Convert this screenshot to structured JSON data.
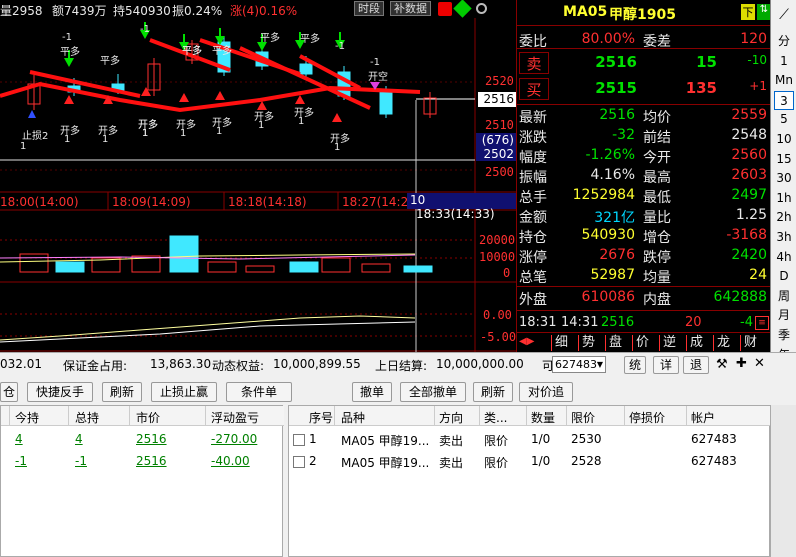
{
  "info": {
    "vol": "量2958",
    "amount": "额7439万",
    "hold": "持540930",
    "amp": "振0.24%",
    "chg": "涨(4)0.16%",
    "btn_period": "时段",
    "btn_supplement": "补数据"
  },
  "chart": {
    "price_labels": [
      "2520",
      "2516",
      "2510",
      "(676)",
      "2502",
      "2500"
    ],
    "vol_labels": [
      "20000",
      "10000",
      "0"
    ],
    "osc_labels": [
      "0.00",
      "-5.00"
    ],
    "time_labels": [
      "18:00(14:00)",
      "18:09(14:09)",
      "18:18(14:18)",
      "18:27(14:2",
      "10",
      "18:33(14:33)"
    ],
    "annotations": [
      {
        "text": "-1"
      },
      {
        "text": "平多"
      },
      {
        "text": "-1"
      },
      {
        "text": "平多"
      },
      {
        "text": "平多"
      },
      {
        "text": "平多"
      },
      {
        "text": "平多"
      },
      {
        "text": "平多"
      },
      {
        "text": "-1"
      },
      {
        "text": "平多"
      },
      {
        "text": "-1"
      },
      {
        "text": "开空"
      },
      {
        "text": "止损2"
      },
      {
        "text": "1"
      },
      {
        "text": "开多"
      },
      {
        "text": "1"
      },
      {
        "text": "开多"
      },
      {
        "text": "1"
      },
      {
        "text": "开多"
      },
      {
        "text": "1"
      },
      {
        "text": "开多"
      },
      {
        "text": "1"
      },
      {
        "text": "开多"
      },
      {
        "text": "1"
      },
      {
        "text": "开多"
      },
      {
        "text": "1"
      },
      {
        "text": "开多"
      },
      {
        "text": "1"
      },
      {
        "text": "开多"
      },
      {
        "text": "1"
      },
      {
        "text": "开多"
      },
      {
        "text": "1"
      }
    ]
  },
  "quote": {
    "symbol": "MA05",
    "name": "甲醇1905",
    "tag_down": "下",
    "rows": [
      {
        "l": "委比",
        "v": "80.00%",
        "l2": "委差",
        "v2": "120"
      },
      {
        "l": "卖",
        "v": "2516",
        "v2": "15",
        "v3": "-10"
      },
      {
        "l": "买",
        "v": "2515",
        "v2": "135",
        "v3": "+1"
      },
      {
        "l": "最新",
        "v": "2516",
        "l2": "均价",
        "v2": "2559"
      },
      {
        "l": "涨跌",
        "v": "-32",
        "l2": "前结",
        "v2": "2548"
      },
      {
        "l": "幅度",
        "v": "-1.26%",
        "l2": "今开",
        "v2": "2560"
      },
      {
        "l": "振幅",
        "v": "4.16%",
        "l2": "最高",
        "v2": "2603"
      },
      {
        "l": "总手",
        "v": "1252984",
        "l2": "最低",
        "v2": "2497"
      },
      {
        "l": "金额",
        "v": "321亿",
        "l2": "量比",
        "v2": "1.25"
      },
      {
        "l": "持仓",
        "v": "540930",
        "l2": "增仓",
        "v2": "-3168"
      },
      {
        "l": "涨停",
        "v": "2676",
        "l2": "跌停",
        "v2": "2420"
      },
      {
        "l": "总笔",
        "v": "52987",
        "l2": "均量",
        "v2": "24"
      },
      {
        "l": "外盘",
        "v": "610086",
        "l2": "内盘",
        "v2": "642888"
      }
    ],
    "tick": {
      "time1": "18:31",
      "time2": "14:31",
      "price": "2516",
      "vol": "20",
      "chg": "-4"
    },
    "tabs": [
      "细",
      "势",
      "盘",
      "价",
      "逆",
      "成",
      "龙",
      "财"
    ]
  },
  "rightbar": [
    "分",
    "1",
    "Mn",
    "3",
    "5",
    "10",
    "15",
    "30",
    "1h",
    "2h",
    "3h",
    "4h",
    "D",
    "周",
    "月",
    "季",
    "年"
  ],
  "account": {
    "available": "032.01",
    "margin_label": "保证金占用:",
    "margin": "13,863.30",
    "equity_label": "动态权益:",
    "equity": "10,000,899.55",
    "settle_label": "上日结算:",
    "settle": "10,000,000.00",
    "ke": "可",
    "qty_value": "627483",
    "btn_tong": "统",
    "btn_xiang": "详",
    "btn_tui": "退"
  },
  "left_buttons": [
    "仓",
    "快捷反手",
    "刷新",
    "止损止赢",
    "条件单"
  ],
  "right_buttons": [
    "撤单",
    "全部撤单",
    "刷新",
    "对价追"
  ],
  "pos_headers": [
    "今持",
    "总持",
    "市价",
    "浮动盈亏"
  ],
  "pos_rows": [
    [
      "4",
      "4",
      "2516",
      "-270.00"
    ],
    [
      "-1",
      "-1",
      "2516",
      "-40.00"
    ]
  ],
  "ord_headers": [
    "序号",
    "品种",
    "方向",
    "类...",
    "数量",
    "限价",
    "停损价",
    "帐户"
  ],
  "ord_rows": [
    [
      "1",
      "MA05 甲醇19...",
      "卖出",
      "限价",
      "1/0",
      "2530",
      "",
      "627483"
    ],
    [
      "2",
      "MA05 甲醇19...",
      "卖出",
      "限价",
      "1/0",
      "2528",
      "",
      "627483"
    ]
  ],
  "colors": {
    "up": "#ff3030",
    "down": "#00e000",
    "accent_yellow": "#ffff30",
    "cyan": "#00d8ff"
  }
}
